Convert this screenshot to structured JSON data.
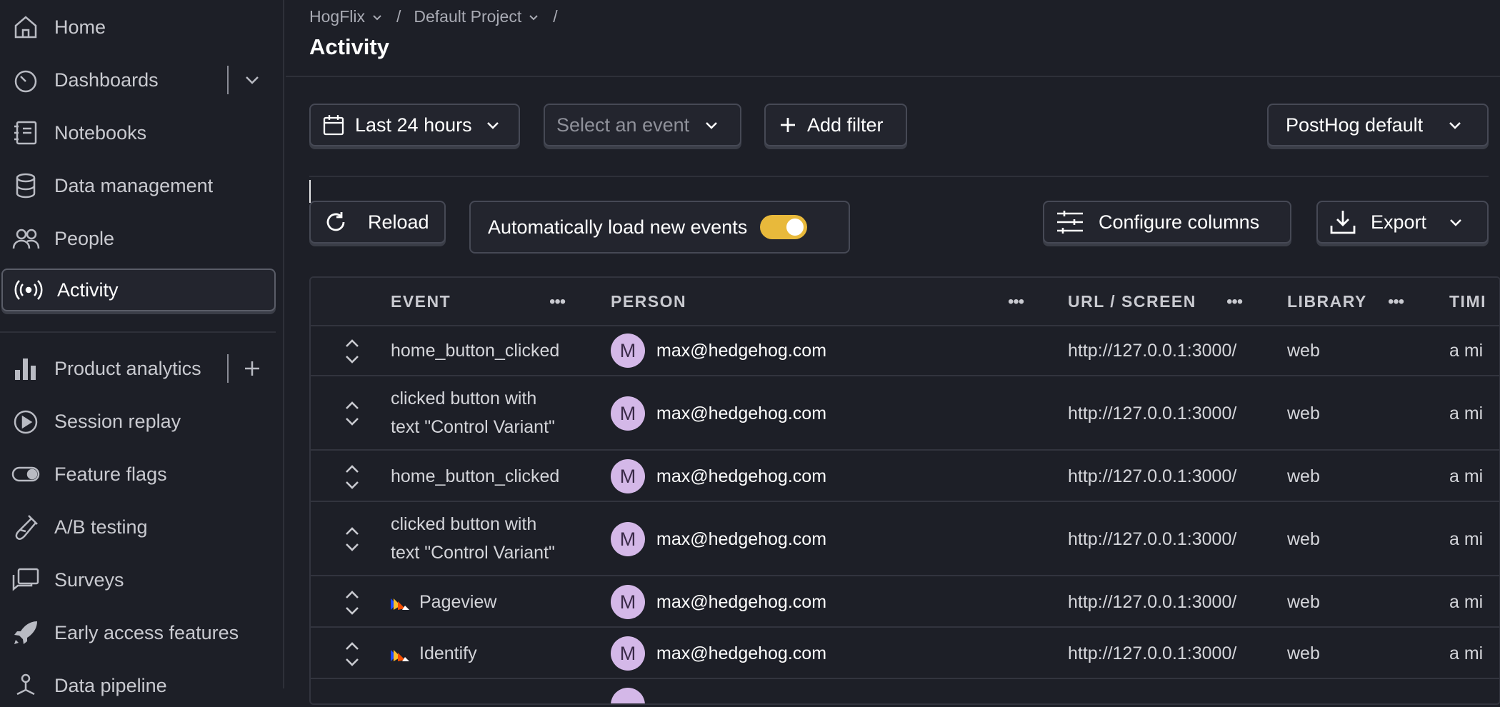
{
  "sidebar": {
    "items": [
      {
        "label": "Home",
        "icon": "home-icon"
      },
      {
        "label": "Dashboards",
        "icon": "dashboard-icon"
      },
      {
        "label": "Notebooks",
        "icon": "notebook-icon"
      },
      {
        "label": "Data management",
        "icon": "database-icon"
      },
      {
        "label": "People",
        "icon": "people-icon"
      },
      {
        "label": "Activity",
        "icon": "activity-icon",
        "active": true
      },
      {
        "label": "Product analytics",
        "icon": "bar-chart-icon"
      },
      {
        "label": "Session replay",
        "icon": "replay-icon"
      },
      {
        "label": "Feature flags",
        "icon": "toggle-icon"
      },
      {
        "label": "A/B testing",
        "icon": "flask-icon"
      },
      {
        "label": "Surveys",
        "icon": "survey-icon"
      },
      {
        "label": "Early access features",
        "icon": "rocket-icon"
      },
      {
        "label": "Data pipeline",
        "icon": "pipeline-icon"
      }
    ]
  },
  "header": {
    "breadcrumb": {
      "org": "HogFlix",
      "project": "Default Project",
      "sep": "/"
    },
    "title": "Activity"
  },
  "filters": {
    "date_range": "Last 24 hours",
    "event_placeholder": "Select an event",
    "add_filter": "Add filter",
    "template": "PostHog default"
  },
  "actions": {
    "reload": "Reload",
    "auto_load": "Automatically load new events",
    "auto_load_on": true,
    "configure_columns": "Configure columns",
    "export": "Export"
  },
  "table": {
    "columns": [
      "EVENT",
      "PERSON",
      "URL / SCREEN",
      "LIBRARY",
      "TIMI"
    ],
    "rows": [
      {
        "event": [
          "home_button_clicked"
        ],
        "person": "max@hedgehog.com",
        "initial": "M",
        "url": "http://127.0.0.1:3000/",
        "library": "web",
        "time": "a mi"
      },
      {
        "event": [
          "clicked button with",
          "text \"Control Variant\""
        ],
        "person": "max@hedgehog.com",
        "initial": "M",
        "url": "http://127.0.0.1:3000/",
        "library": "web",
        "time": "a mi"
      },
      {
        "event": [
          "home_button_clicked"
        ],
        "person": "max@hedgehog.com",
        "initial": "M",
        "url": "http://127.0.0.1:3000/",
        "library": "web",
        "time": "a mi"
      },
      {
        "event": [
          "clicked button with",
          "text \"Control Variant\""
        ],
        "person": "max@hedgehog.com",
        "initial": "M",
        "url": "http://127.0.0.1:3000/",
        "library": "web",
        "time": "a mi"
      },
      {
        "event": [
          "Pageview"
        ],
        "flag": true,
        "person": "max@hedgehog.com",
        "initial": "M",
        "url": "http://127.0.0.1:3000/",
        "library": "web",
        "time": "a mi"
      },
      {
        "event": [
          "Identify"
        ],
        "flag": true,
        "person": "max@hedgehog.com",
        "initial": "M",
        "url": "http://127.0.0.1:3000/",
        "library": "web",
        "time": "a mi"
      }
    ]
  },
  "colors": {
    "accent": "#e8b93b",
    "avatar": "#d4b8e8",
    "background": "#1d1f27"
  }
}
